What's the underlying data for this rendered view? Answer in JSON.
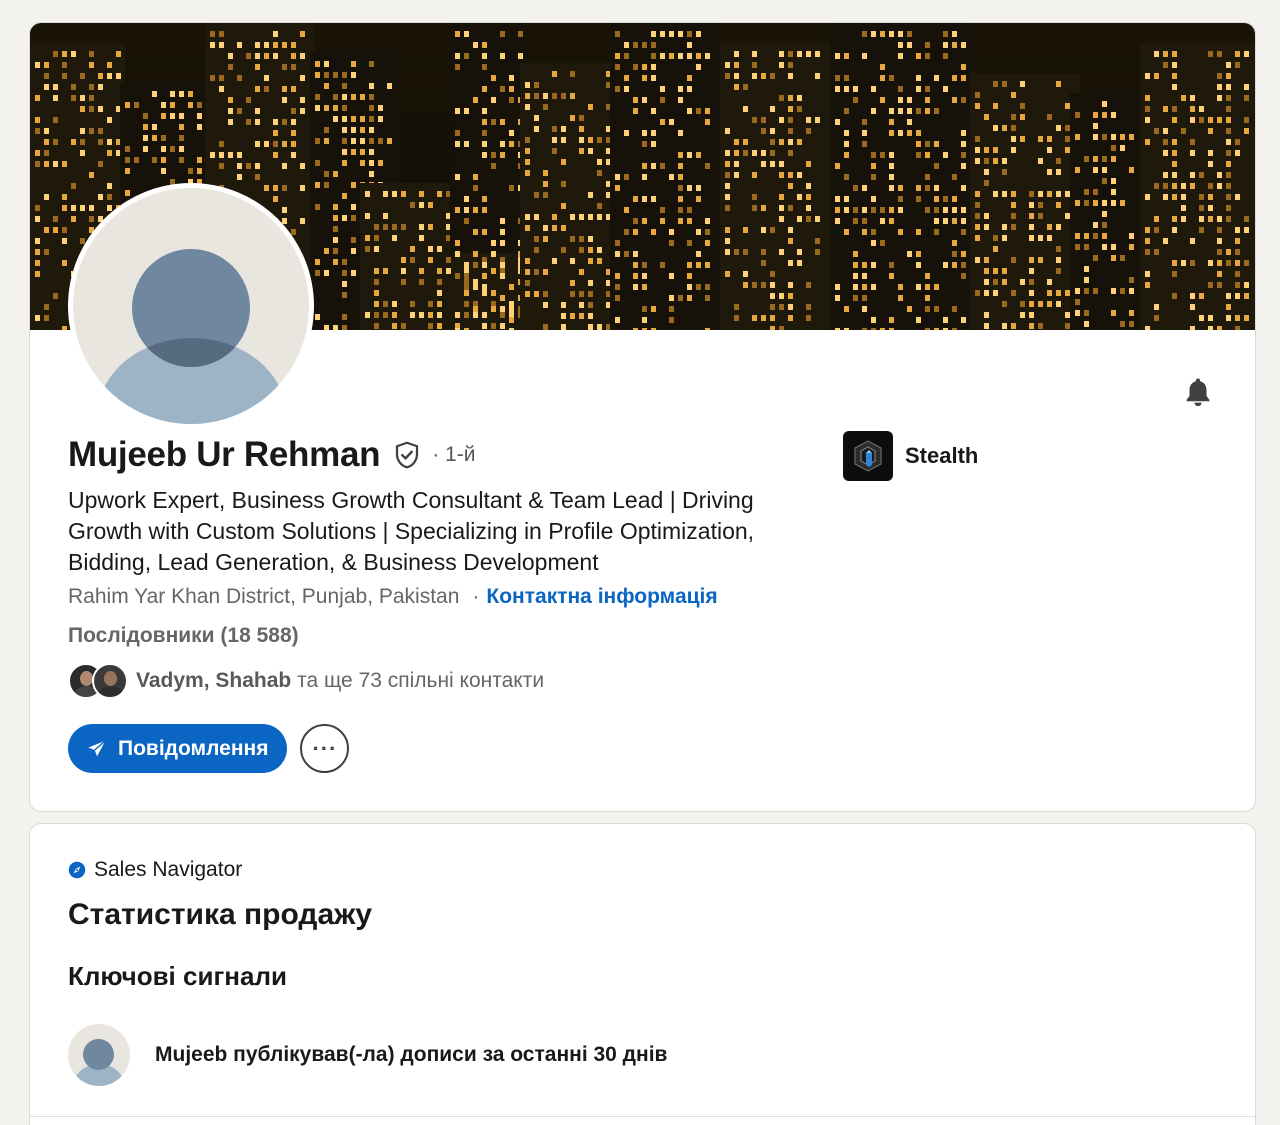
{
  "profile": {
    "name": "Mujeeb Ur Rehman",
    "degree": "· 1-й",
    "headline": "Upwork Expert, Business Growth Consultant & Team Lead | Driving Growth with Custom Solutions | Specializing in Profile Optimization, Bidding, Lead Generation, & Business Development",
    "location": "Rahim Yar Khan District, Punjab, Pakistan",
    "location_separator": "·",
    "contact_link": "Контактна інформація",
    "followers": "Послідовники (18 588)",
    "mutual_names": "Vadym, Shahab",
    "mutual_rest": " та ще 73 спільні контакти",
    "message_button": "Повідомлення",
    "more_button": "···"
  },
  "company": {
    "name": "Stealth"
  },
  "sales": {
    "brand": "Sales Navigator",
    "title": "Статистика продажу",
    "signals_title": "Ключові сигнали",
    "signal_text": "Mujeeb публікував(-ла) дописи за останні 30 днів"
  },
  "colors": {
    "accent": "#0a66c2",
    "page_bg": "#f3f2ef"
  }
}
